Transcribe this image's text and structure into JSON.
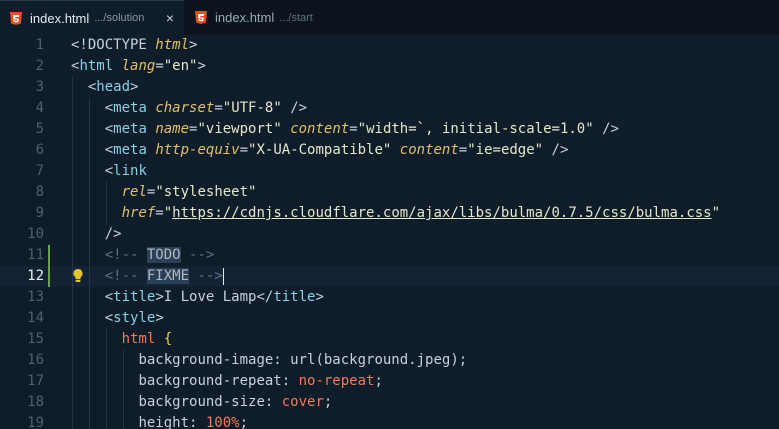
{
  "tabs": [
    {
      "title": "index.html",
      "description": ".../solution",
      "active": true,
      "close": "×"
    },
    {
      "title": "index.html",
      "description": ".../start",
      "active": false
    }
  ],
  "colors": {
    "html_icon": "#e44d26",
    "modified_gutter": "#6ba04c",
    "lightbulb": "#e3c32d"
  },
  "gutter_icons": [
    "lightbulb-icon"
  ],
  "current_line": 12,
  "lines": [
    {
      "n": "1",
      "tokens": [
        [
          "c-punct",
          "<!DOCTYPE "
        ],
        [
          "c-attr",
          "html"
        ],
        [
          "c-punct",
          ">"
        ]
      ]
    },
    {
      "n": "2",
      "tokens": [
        [
          "c-punct",
          "<"
        ],
        [
          "c-tag",
          "html"
        ],
        [
          "c-punct",
          " "
        ],
        [
          "c-attr",
          "lang"
        ],
        [
          "c-punct",
          "="
        ],
        [
          "c-str",
          "\"en\""
        ],
        [
          "c-punct",
          ">"
        ]
      ]
    },
    {
      "n": "3",
      "tokens": [
        [
          "c-punct",
          "  <"
        ],
        [
          "c-tag",
          "head"
        ],
        [
          "c-punct",
          ">"
        ]
      ]
    },
    {
      "n": "4",
      "tokens": [
        [
          "c-punct",
          "    <"
        ],
        [
          "c-tag",
          "meta"
        ],
        [
          "c-punct",
          " "
        ],
        [
          "c-attr",
          "charset"
        ],
        [
          "c-punct",
          "="
        ],
        [
          "c-str",
          "\"UTF-8\""
        ],
        [
          "c-punct",
          " />"
        ]
      ]
    },
    {
      "n": "5",
      "tokens": [
        [
          "c-punct",
          "    <"
        ],
        [
          "c-tag",
          "meta"
        ],
        [
          "c-punct",
          " "
        ],
        [
          "c-attr",
          "name"
        ],
        [
          "c-punct",
          "="
        ],
        [
          "c-str",
          "\"viewport\""
        ],
        [
          "c-punct",
          " "
        ],
        [
          "c-attr",
          "content"
        ],
        [
          "c-punct",
          "="
        ],
        [
          "c-str",
          "\"width=`, initial-scale=1.0\""
        ],
        [
          "c-punct",
          " />"
        ]
      ]
    },
    {
      "n": "6",
      "tokens": [
        [
          "c-punct",
          "    <"
        ],
        [
          "c-tag",
          "meta"
        ],
        [
          "c-punct",
          " "
        ],
        [
          "c-attr",
          "http-equiv"
        ],
        [
          "c-punct",
          "="
        ],
        [
          "c-str",
          "\"X-UA-Compatible\""
        ],
        [
          "c-punct",
          " "
        ],
        [
          "c-attr",
          "content"
        ],
        [
          "c-punct",
          "="
        ],
        [
          "c-str",
          "\"ie=edge\""
        ],
        [
          "c-punct",
          " />"
        ]
      ]
    },
    {
      "n": "7",
      "tokens": [
        [
          "c-punct",
          "    <"
        ],
        [
          "c-tag",
          "link"
        ]
      ]
    },
    {
      "n": "8",
      "tokens": [
        [
          "c-punct",
          "      "
        ],
        [
          "c-attr",
          "rel"
        ],
        [
          "c-punct",
          "="
        ],
        [
          "c-str",
          "\"stylesheet\""
        ]
      ]
    },
    {
      "n": "9",
      "tokens": [
        [
          "c-punct",
          "      "
        ],
        [
          "c-attr",
          "href"
        ],
        [
          "c-punct",
          "="
        ],
        [
          "c-str",
          "\""
        ],
        [
          "c-url",
          "https://cdnjs.cloudflare.com/ajax/libs/bulma/0.7.5/css/bulma.css"
        ],
        [
          "c-str",
          "\""
        ]
      ]
    },
    {
      "n": "10",
      "tokens": [
        [
          "c-punct",
          "    />"
        ]
      ]
    },
    {
      "n": "11",
      "tokens": [
        [
          "c-punct",
          "    "
        ],
        [
          "c-cmt",
          "<!-- "
        ],
        [
          "c-kw",
          "TODO"
        ],
        [
          "c-cmt",
          " -->"
        ]
      ]
    },
    {
      "n": "12",
      "tokens": [
        [
          "c-punct",
          "    "
        ],
        [
          "c-cmt",
          "<!-- "
        ],
        [
          "c-kw",
          "FIXME"
        ],
        [
          "c-cmt",
          " -->"
        ]
      ]
    },
    {
      "n": "13",
      "tokens": [
        [
          "c-punct",
          "    <"
        ],
        [
          "c-tag",
          "title"
        ],
        [
          "c-punct",
          ">I Love Lamp</"
        ],
        [
          "c-tag",
          "title"
        ],
        [
          "c-punct",
          ">"
        ]
      ]
    },
    {
      "n": "14",
      "tokens": [
        [
          "c-punct",
          "    <"
        ],
        [
          "c-tag",
          "style"
        ],
        [
          "c-punct",
          ">"
        ]
      ]
    },
    {
      "n": "15",
      "tokens": [
        [
          "c-punct",
          "      "
        ],
        [
          "c-sel",
          "html"
        ],
        [
          "c-punct",
          " "
        ],
        [
          "c-brace",
          "{"
        ]
      ]
    },
    {
      "n": "16",
      "tokens": [
        [
          "c-punct",
          "        "
        ],
        [
          "c-prop",
          "background-image"
        ],
        [
          "c-punct",
          ": "
        ],
        [
          "c-fn",
          "url"
        ],
        [
          "c-punct",
          "(background.jpeg);"
        ]
      ]
    },
    {
      "n": "17",
      "tokens": [
        [
          "c-punct",
          "        "
        ],
        [
          "c-prop",
          "background-repeat"
        ],
        [
          "c-punct",
          ": "
        ],
        [
          "c-val",
          "no-repeat"
        ],
        [
          "c-punct",
          ";"
        ]
      ]
    },
    {
      "n": "18",
      "tokens": [
        [
          "c-punct",
          "        "
        ],
        [
          "c-prop",
          "background-size"
        ],
        [
          "c-punct",
          ": "
        ],
        [
          "c-val",
          "cover"
        ],
        [
          "c-punct",
          ";"
        ]
      ]
    },
    {
      "n": "19",
      "tokens": [
        [
          "c-punct",
          "        "
        ],
        [
          "c-prop",
          "height"
        ],
        [
          "c-punct",
          ": "
        ],
        [
          "c-num",
          "100%"
        ],
        [
          "c-punct",
          ";"
        ]
      ]
    }
  ]
}
